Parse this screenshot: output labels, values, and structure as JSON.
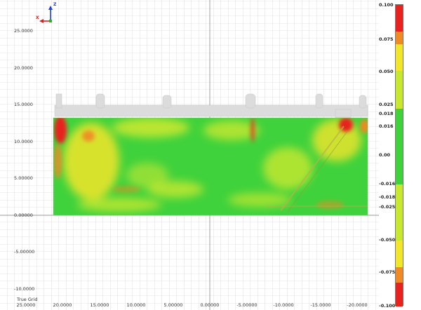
{
  "view": {
    "grid_label": "True Grid",
    "y_axis_labels": [
      "25.0000",
      "20.0000",
      "15.0000",
      "10.0000",
      "5.00000",
      "0.00000",
      "-5.00000",
      "-10.0000"
    ],
    "x_axis_labels": [
      "25.0000",
      "20.0000",
      "15.0000",
      "10.0000",
      "5.00000",
      "0.00000",
      "-5.00000",
      "-10.0000",
      "-15.0000",
      "-20.0000"
    ],
    "axis_triad": {
      "vertical": "Z",
      "horizontal": "X"
    }
  },
  "legend": {
    "labels": [
      "0.100",
      "0.075",
      "0.050",
      "0.025",
      "0.018",
      "0.016",
      "0.00",
      "-0.016",
      "-0.018",
      "-0.025",
      "-0.050",
      "-0.075",
      "-0.100"
    ],
    "colors": {
      "red": "#e8221e",
      "orange": "#f08a24",
      "yellow": "#f2e52a",
      "yellow_green": "#c8e830",
      "green": "#3fd23c"
    }
  }
}
